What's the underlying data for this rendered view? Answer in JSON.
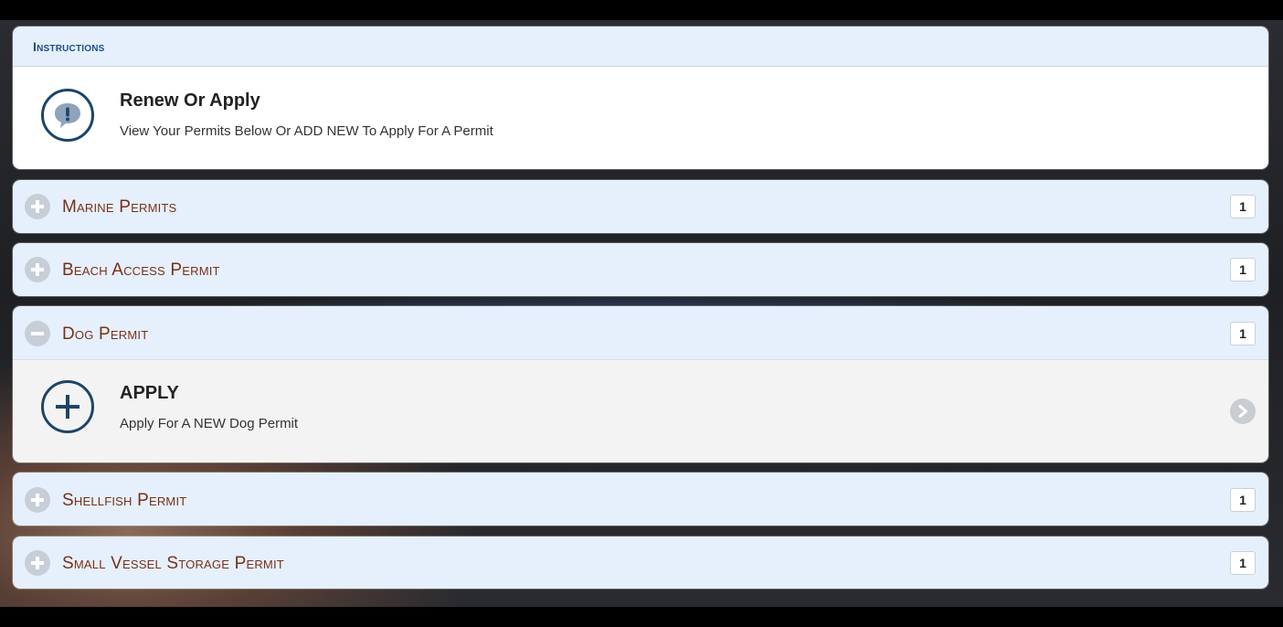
{
  "instructions": {
    "header": "Instructions",
    "title": "Renew Or Apply",
    "subtitle": "View Your Permits Below Or ADD NEW To Apply For A Permit",
    "icon": "speech-bubble-alert-icon"
  },
  "sections": [
    {
      "title": "Marine Permits",
      "count": "1",
      "expanded": false
    },
    {
      "title": "Beach Access Permit",
      "count": "1",
      "expanded": false
    },
    {
      "title": "Dog Permit",
      "count": "1",
      "expanded": true
    },
    {
      "title": "Shellfish Permit",
      "count": "1",
      "expanded": false
    },
    {
      "title": "Small Vessel Storage Permit",
      "count": "1",
      "expanded": false
    }
  ],
  "dog_apply": {
    "title": "APPLY",
    "subtitle": "Apply For A NEW Dog Permit",
    "icon": "plus-circle-icon"
  },
  "colors": {
    "header_bg": "#e5f0fc",
    "instructions_header_text": "#1c4c8e",
    "section_title_text": "#7b2f16",
    "icon_navy": "#1e4468"
  }
}
